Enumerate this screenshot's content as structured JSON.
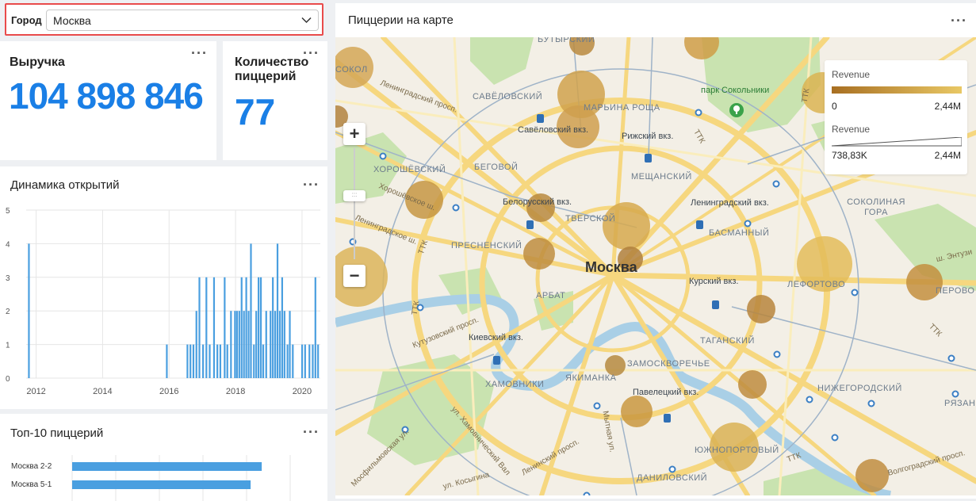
{
  "filter": {
    "label": "Город",
    "value": "Москва"
  },
  "kpi_revenue": {
    "title": "Выручка",
    "value": "104 898 846"
  },
  "kpi_count": {
    "title": "Количество пиццерий",
    "value": "77"
  },
  "opens_chart": {
    "title": "Динамика открытий",
    "chart_data": {
      "type": "bar",
      "title": "Динамика открытий",
      "y_ticks": [
        0,
        1,
        2,
        3,
        4,
        5
      ],
      "ylim": [
        0,
        5
      ],
      "x_ticks": [
        "2012",
        "2014",
        "2016",
        "2018",
        "2020"
      ],
      "xlim": [
        2011.7,
        2020.55
      ],
      "grid": true,
      "bars": [
        {
          "x": 2011.78,
          "v": 4
        },
        {
          "x": 2015.93,
          "v": 1
        },
        {
          "x": 2016.55,
          "v": 1
        },
        {
          "x": 2016.64,
          "v": 1
        },
        {
          "x": 2016.73,
          "v": 1
        },
        {
          "x": 2016.82,
          "v": 2
        },
        {
          "x": 2016.91,
          "v": 3
        },
        {
          "x": 2017.02,
          "v": 1
        },
        {
          "x": 2017.12,
          "v": 3
        },
        {
          "x": 2017.22,
          "v": 1
        },
        {
          "x": 2017.35,
          "v": 3
        },
        {
          "x": 2017.45,
          "v": 1
        },
        {
          "x": 2017.54,
          "v": 1
        },
        {
          "x": 2017.67,
          "v": 3
        },
        {
          "x": 2017.75,
          "v": 1
        },
        {
          "x": 2017.86,
          "v": 2
        },
        {
          "x": 2017.98,
          "v": 2
        },
        {
          "x": 2018.04,
          "v": 2
        },
        {
          "x": 2018.11,
          "v": 2
        },
        {
          "x": 2018.18,
          "v": 3
        },
        {
          "x": 2018.25,
          "v": 2
        },
        {
          "x": 2018.32,
          "v": 3
        },
        {
          "x": 2018.39,
          "v": 2
        },
        {
          "x": 2018.46,
          "v": 4
        },
        {
          "x": 2018.55,
          "v": 1
        },
        {
          "x": 2018.62,
          "v": 2
        },
        {
          "x": 2018.69,
          "v": 3
        },
        {
          "x": 2018.76,
          "v": 3
        },
        {
          "x": 2018.83,
          "v": 1
        },
        {
          "x": 2018.92,
          "v": 2
        },
        {
          "x": 2019.05,
          "v": 2
        },
        {
          "x": 2019.12,
          "v": 3
        },
        {
          "x": 2019.19,
          "v": 2
        },
        {
          "x": 2019.26,
          "v": 4
        },
        {
          "x": 2019.33,
          "v": 2
        },
        {
          "x": 2019.4,
          "v": 3
        },
        {
          "x": 2019.47,
          "v": 2
        },
        {
          "x": 2019.56,
          "v": 1
        },
        {
          "x": 2019.63,
          "v": 2
        },
        {
          "x": 2019.72,
          "v": 1
        },
        {
          "x": 2020.0,
          "v": 1
        },
        {
          "x": 2020.09,
          "v": 1
        },
        {
          "x": 2020.22,
          "v": 1
        },
        {
          "x": 2020.32,
          "v": 1
        },
        {
          "x": 2020.4,
          "v": 3
        },
        {
          "x": 2020.48,
          "v": 1
        }
      ],
      "bar_color": "#4a9fe0"
    }
  },
  "top10": {
    "title": "Топ-10 пиццерий",
    "chart_data": {
      "type": "bar",
      "orientation": "horizontal",
      "categories": [
        "Москва 2-2",
        "Москва 5-1"
      ],
      "values": [
        2.39,
        2.25
      ],
      "bar_color": "#4a9fe0"
    }
  },
  "map": {
    "title": "Пиццерии на карте",
    "city_label": "Москва",
    "legend": {
      "color_title": "Revenue",
      "color_min": "0",
      "color_max": "2,44M",
      "size_title": "Revenue",
      "size_min": "738,83K",
      "size_max": "2,44M"
    },
    "labels": {
      "butyrsky": "БУТЫРСКИЙ",
      "sokol": "СОКОЛ",
      "leningradsky_prosp": "Ленинградский просп.",
      "savelovsky": "САВЁЛОВСКИЙ",
      "savelovsky_vkz": "Савёловский вкз.",
      "maryina_roscha": "МАРЬИНА РОЩА",
      "rizhsky_vkz": "Рижский вкз.",
      "park_sokolniki": "парк Сокольники",
      "khoroshevsky": "ХОРОШЁВСКИЙ",
      "begovoy": "БЕГОВОЙ",
      "khoroshevskoe": "Хорошёвское ш.",
      "leningradskoe_sh": "Ленинградское ш.",
      "belorussky_vkz": "Белорусский вкз.",
      "tverskoy": "ТВЕРСКОЙ",
      "meschansky": "МЕЩАНСКИЙ",
      "leningradsky_vkz": "Ленинградский вкз.",
      "sokolnaya_gora": "СОКОЛИНАЯ ГОРА",
      "presnensky": "ПРЕСНЕНСКИЙ",
      "basmanny": "БАСМАННЫЙ",
      "kursky_vkz": "Курский вкз.",
      "lefortovo": "ЛЕФОРТОВО",
      "perovo": "ПЕРОВО",
      "arbat": "АРБАТ",
      "kutuzovsky": "Кутузовский просп.",
      "kievsky_vkz": "Киевский вкз.",
      "tagansky": "ТАГАНСКИЙ",
      "zamoskvorechye": "ЗАМОСКВОРЕЧЬЕ",
      "khamovniki": "ХАМОВНИКИ",
      "yakimanka": "ЯКИМАНКА",
      "paveletsky_vkz": "Павелецкий вкз.",
      "nizhegorodsky": "НИЖЕГОРОДСКИЙ",
      "ryazansky": "РЯЗАНСКИЙ",
      "yuzhnoportovy": "ЮЖНОПОРТОВЫЙ",
      "danilovsky": "ДАНИЛОВСКИЙ",
      "mosfilmovskaya": "Мосфильмовская ул.",
      "leninsky_prosp": "Ленинский просп.",
      "kosygina": "ул. Косыгина",
      "khamovnichesky_val": "ул. Хамовнический Вал",
      "mytnaya": "Мытная ул.",
      "volgogradsky": "Волгоградский просп.",
      "entuziastov": "ш. Энтузи",
      "ttk_1": "ТТК",
      "ttk_2": "ТТК",
      "ttk_3": "ТТК",
      "ttk_4": "ТТК",
      "ttk_5": "ТТК",
      "ttk_6": "ТТК"
    },
    "points": [
      {
        "x": 310,
        "y": 72,
        "r": 30,
        "c": "#d0a24c"
      },
      {
        "x": 311,
        "y": 7,
        "r": 16,
        "c": "#b98a3e"
      },
      {
        "x": 462,
        "y": 6,
        "r": 22,
        "c": "#cf9e47"
      },
      {
        "x": 22,
        "y": 38,
        "r": 26,
        "c": "#d4a756"
      },
      {
        "x": 306,
        "y": 113,
        "r": 27,
        "c": "#cf9f4d"
      },
      {
        "x": 2,
        "y": 100,
        "r": 14,
        "c": "#b2823e"
      },
      {
        "x": 112,
        "y": 205,
        "r": 24,
        "c": "#c69743"
      },
      {
        "x": 259,
        "y": 215,
        "r": 18,
        "c": "#b98a3e"
      },
      {
        "x": 367,
        "y": 238,
        "r": 30,
        "c": "#d6a94e"
      },
      {
        "x": 257,
        "y": 273,
        "r": 20,
        "c": "#be8d3e"
      },
      {
        "x": 372,
        "y": 280,
        "r": 16,
        "c": "#b0803c"
      },
      {
        "x": 28,
        "y": 302,
        "r": 38,
        "c": "#dcb55a"
      },
      {
        "x": 617,
        "y": 286,
        "r": 35,
        "c": "#e3bc59"
      },
      {
        "x": 743,
        "y": 309,
        "r": 23,
        "c": "#c38f3e"
      },
      {
        "x": 537,
        "y": 343,
        "r": 18,
        "c": "#b7853c"
      },
      {
        "x": 353,
        "y": 414,
        "r": 13,
        "c": "#b58a40"
      },
      {
        "x": 526,
        "y": 438,
        "r": 18,
        "c": "#be8c3e"
      },
      {
        "x": 380,
        "y": 472,
        "r": 20,
        "c": "#c9983f"
      },
      {
        "x": 503,
        "y": 517,
        "r": 31,
        "c": "#d9b153"
      },
      {
        "x": 677,
        "y": 553,
        "r": 21,
        "c": "#c08d40"
      },
      {
        "x": 614,
        "y": 70,
        "r": 26,
        "c": "#dab452"
      }
    ]
  }
}
